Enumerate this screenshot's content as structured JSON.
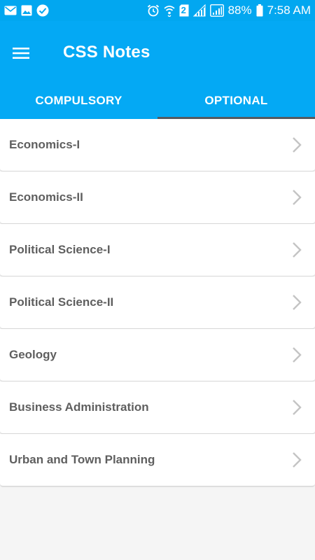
{
  "status_bar": {
    "battery_percent": "88%",
    "time": "7:58 AM",
    "sim_slot": "2",
    "icons_left": [
      "email-icon",
      "image-icon",
      "check-circle-icon"
    ],
    "icons_right": [
      "alarm-icon",
      "wifi-icon",
      "sim-2-icon",
      "signal-icon",
      "signal-boxed-icon",
      "battery-icon"
    ]
  },
  "app_bar": {
    "title": "CSS Notes",
    "menu_icon": "hamburger-menu-icon",
    "color": "#04a9f4"
  },
  "tabs": [
    {
      "label": "COMPULSORY",
      "active": false
    },
    {
      "label": "OPTIONAL",
      "active": true
    }
  ],
  "subjects": [
    {
      "label": "Economics-I"
    },
    {
      "label": "Economics-II"
    },
    {
      "label": "Political Science-I"
    },
    {
      "label": "Political Science-II"
    },
    {
      "label": "Geology"
    },
    {
      "label": "Business Administration"
    },
    {
      "label": "Urban and Town Planning"
    }
  ],
  "colors": {
    "accent": "#04a9f4",
    "tab_indicator": "#555a60",
    "item_text": "#5f5f5f",
    "background": "#f5f5f5"
  }
}
